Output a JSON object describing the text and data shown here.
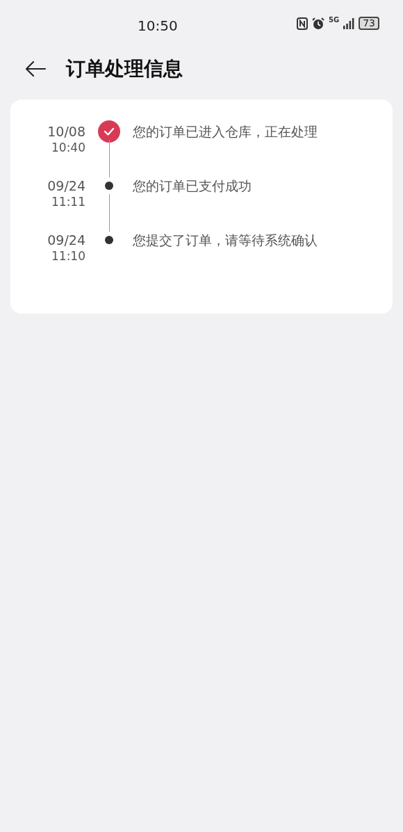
{
  "status_bar": {
    "time": "10:50",
    "network": "5G",
    "battery": "73"
  },
  "header": {
    "title": "订单处理信息"
  },
  "timeline": [
    {
      "date": "10/08",
      "time": "10:40",
      "message": "您的订单已进入仓库，正在处理",
      "current": true
    },
    {
      "date": "09/24",
      "time": "11:11",
      "message": "您的订单已支付成功",
      "current": false
    },
    {
      "date": "09/24",
      "time": "11:10",
      "message": "您提交了订单，请等待系统确认",
      "current": false
    }
  ]
}
